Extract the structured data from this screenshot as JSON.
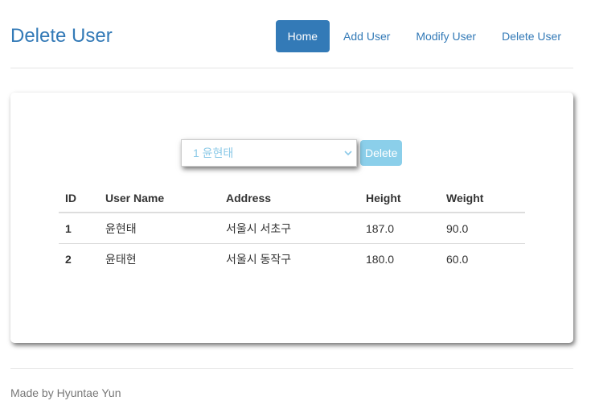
{
  "header": {
    "title": "Delete User",
    "nav": [
      "Home",
      "Add User",
      "Modify User",
      "Delete User"
    ]
  },
  "controls": {
    "selected_user": "1 윤현태",
    "delete_label": "Delete"
  },
  "table": {
    "headers": [
      "ID",
      "User Name",
      "Address",
      "Height",
      "Weight"
    ],
    "rows": [
      [
        "1",
        "윤현태",
        "서울시 서초구",
        "187.0",
        "90.0"
      ],
      [
        "2",
        "윤태현",
        "서울시 동작구",
        "180.0",
        "60.0"
      ]
    ]
  },
  "footer": {
    "text": "Made by Hyuntae Yun"
  },
  "colors": {
    "primary": "#337ab7",
    "delete_button": "#8bcfea"
  }
}
